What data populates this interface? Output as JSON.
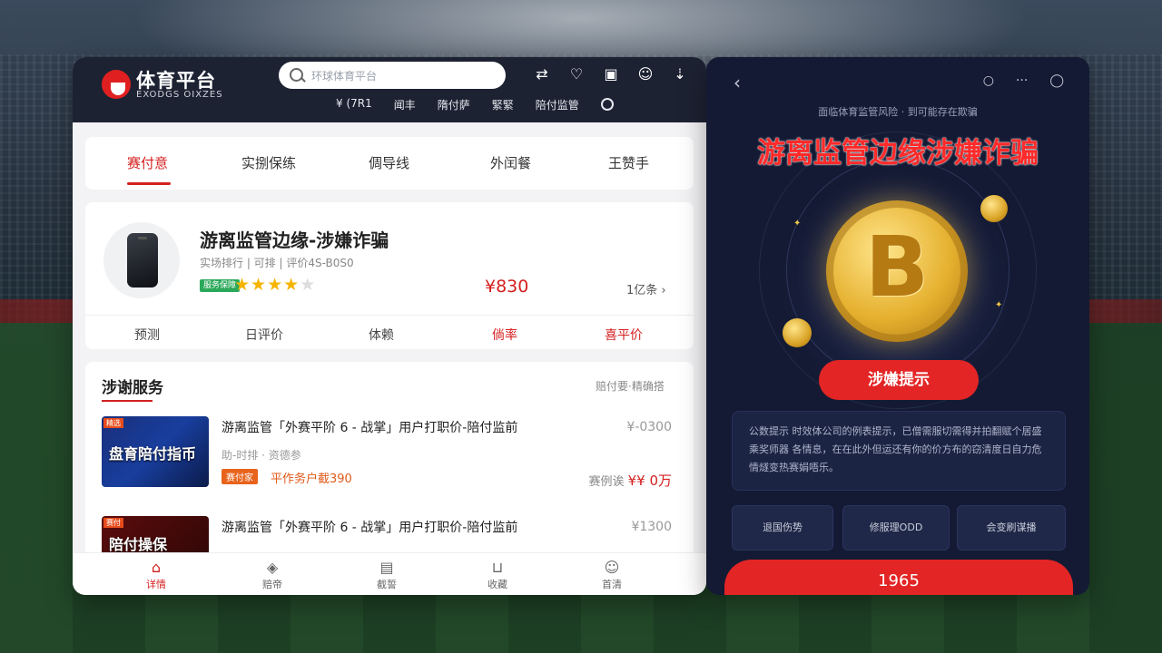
{
  "left": {
    "logo": {
      "title": "体育平台",
      "subtitle": "EXODGS OIXZES"
    },
    "search_placeholder": "环球体育平台",
    "top_icons": [
      "pay-icon",
      "ticket-icon",
      "card-icon",
      "user-icon",
      "download-icon"
    ],
    "topnav": [
      "¥ (7R1",
      "闻丰",
      "隋付萨",
      "緊緊",
      "陪付监管"
    ],
    "tabs": [
      "赛付意",
      "实捌保练",
      "倜导线",
      "外闰餐",
      "王赞手"
    ],
    "product": {
      "title": "游离监管边缘-涉嫌诈骗",
      "subtitle": "实场排行 | 可排 | 评价4S-B0S0",
      "badge": "服务保障",
      "stars_filled": 4,
      "stars_total": 5,
      "price": "¥830",
      "more": "1亿条 ›",
      "actions": [
        "预测",
        "日评价",
        "体赖",
        "倘率",
        "喜平价"
      ]
    },
    "services": {
      "title": "涉谢服务",
      "right": "赔付要·精确搭",
      "items": [
        {
          "tag": "精选",
          "thumb_text": "盘育陪付指币",
          "title": "游离监管「外赛平阶 6 - 战掌」用户打职价-陪付监前",
          "meta": "助-时排 · 资德参",
          "badge": "赛付家",
          "note": "平作务户截390",
          "price": "¥-0300",
          "price2_label": "赛例诶",
          "price2_value": "¥¥ 0万"
        },
        {
          "tag": "赛付",
          "thumb_text": "陪付操保",
          "title": "游离监管「外赛平阶 6 - 战掌」用户打职价-陪付监前",
          "meta": "",
          "badge": "",
          "note": "",
          "price": "¥1300",
          "price2_label": "",
          "price2_value": ""
        }
      ]
    },
    "bottom_nav": [
      {
        "label": "详情",
        "icon": "home-icon"
      },
      {
        "label": "赔帝",
        "icon": "compass-icon"
      },
      {
        "label": "截誓",
        "icon": "message-icon"
      },
      {
        "label": "收藏",
        "icon": "bookmark-icon"
      },
      {
        "label": "首清",
        "icon": "profile-icon"
      }
    ]
  },
  "right": {
    "subtitle": "面临体育监管风险 · 到可能存在欺骗",
    "title": "游离监管边缘涉嫌诈骗",
    "coin_symbol": "B",
    "button": "涉嫌提示",
    "notice": "公数提示 时效体公司的例表提示，已僧需服切需得并拍翻赋个居盛乘奖师器 各情息，在在此外但运还有你的价方布的窃清度日自力危情燧变热赛娟唔乐。",
    "options": [
      "退国伤势",
      "修服理ODD",
      "会变刷谋播"
    ],
    "big_button": "1965"
  },
  "colors": {
    "accent": "#d42020",
    "dark_panel": "#141a33",
    "topbar": "#1d2233"
  }
}
